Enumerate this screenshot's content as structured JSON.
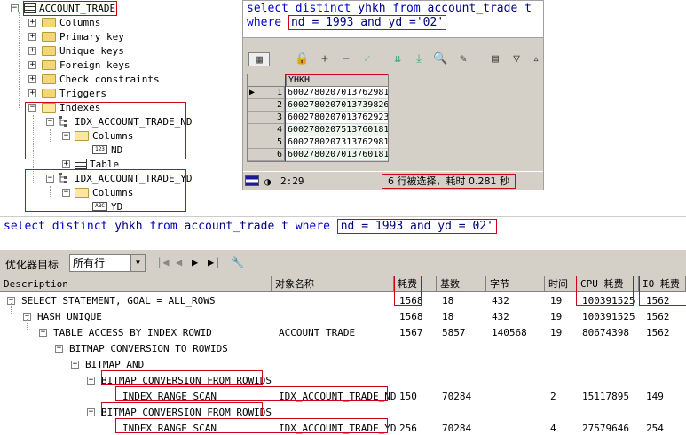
{
  "tree": {
    "table_name": "ACCOUNT_TRADE",
    "nodes": [
      "Columns",
      "Primary key",
      "Unique keys",
      "Foreign keys",
      "Check constraints",
      "Triggers",
      "Indexes"
    ],
    "index1": {
      "name": "IDX_ACCOUNT_TRADE_ND",
      "columns_label": "Columns",
      "column": "ND",
      "col_icon": "123"
    },
    "table_label": "Table",
    "index2": {
      "name": "IDX_ACCOUNT_TRADE_YD",
      "columns_label": "Columns",
      "column": "YD",
      "col_icon": "ABC"
    }
  },
  "sql_editor": {
    "line1": {
      "select": "select",
      "distinct": "distinct",
      "col": "yhkh",
      "from": "from",
      "table": "account_trade t"
    },
    "line2": {
      "where": "where",
      "cond": "nd = 1993 and yd ='02'"
    }
  },
  "grid": {
    "header": "YHKH",
    "rows": [
      {
        "n": "1",
        "v": "6002780207013762981"
      },
      {
        "n": "2",
        "v": "6002780207013739826"
      },
      {
        "n": "3",
        "v": "6002780207013762923"
      },
      {
        "n": "4",
        "v": "6002780207513760181"
      },
      {
        "n": "5",
        "v": "6002780207313762981"
      },
      {
        "n": "6",
        "v": "6002780207013760181"
      }
    ]
  },
  "status": {
    "time": "2:29",
    "message": "6 行被选择，耗时 0.281 秒"
  },
  "query": {
    "prefix": "select distinct yhkh from account_trade t where ",
    "cond": "nd = 1993 and yd ='02'"
  },
  "optimizer": {
    "label": "优化器目标",
    "mode": "所有行"
  },
  "plan": {
    "headers": [
      "Description",
      "对象名称",
      "耗费",
      "基数",
      "字节",
      "时间",
      "CPU 耗费",
      "IO 耗费"
    ],
    "rows": [
      {
        "desc": "SELECT STATEMENT, GOAL = ALL_ROWS",
        "obj": "",
        "cost": "1568",
        "card": "18",
        "bytes": "432",
        "time": "19",
        "cpu": "100391525",
        "io": "1562"
      },
      {
        "desc": "HASH UNIQUE",
        "obj": "",
        "cost": "1568",
        "card": "18",
        "bytes": "432",
        "time": "19",
        "cpu": "100391525",
        "io": "1562"
      },
      {
        "desc": "TABLE ACCESS BY INDEX ROWID",
        "obj": "ACCOUNT_TRADE",
        "cost": "1567",
        "card": "5857",
        "bytes": "140568",
        "time": "19",
        "cpu": "80674398",
        "io": "1562"
      },
      {
        "desc": "BITMAP CONVERSION TO ROWIDS",
        "obj": "",
        "cost": "",
        "card": "",
        "bytes": "",
        "time": "",
        "cpu": "",
        "io": ""
      },
      {
        "desc": "BITMAP AND",
        "obj": "",
        "cost": "",
        "card": "",
        "bytes": "",
        "time": "",
        "cpu": "",
        "io": ""
      },
      {
        "desc": "BITMAP CONVERSION FROM ROWIDS",
        "obj": "",
        "cost": "",
        "card": "",
        "bytes": "",
        "time": "",
        "cpu": "",
        "io": ""
      },
      {
        "desc": "INDEX RANGE SCAN",
        "obj": "IDX_ACCOUNT_TRADE_ND",
        "cost": "150",
        "card": "70284",
        "bytes": "",
        "time": "2",
        "cpu": "15117895",
        "io": "149"
      },
      {
        "desc": "BITMAP CONVERSION FROM ROWIDS",
        "obj": "",
        "cost": "",
        "card": "",
        "bytes": "",
        "time": "",
        "cpu": "",
        "io": ""
      },
      {
        "desc": "INDEX RANGE SCAN",
        "obj": "IDX_ACCOUNT_TRADE_YD",
        "cost": "256",
        "card": "70284",
        "bytes": "",
        "time": "4",
        "cpu": "27579646",
        "io": "254"
      }
    ]
  },
  "colors": {
    "keyword": "#0000c8",
    "highlight_box": "#d0021b",
    "panel_bg": "#d4d0c8"
  }
}
